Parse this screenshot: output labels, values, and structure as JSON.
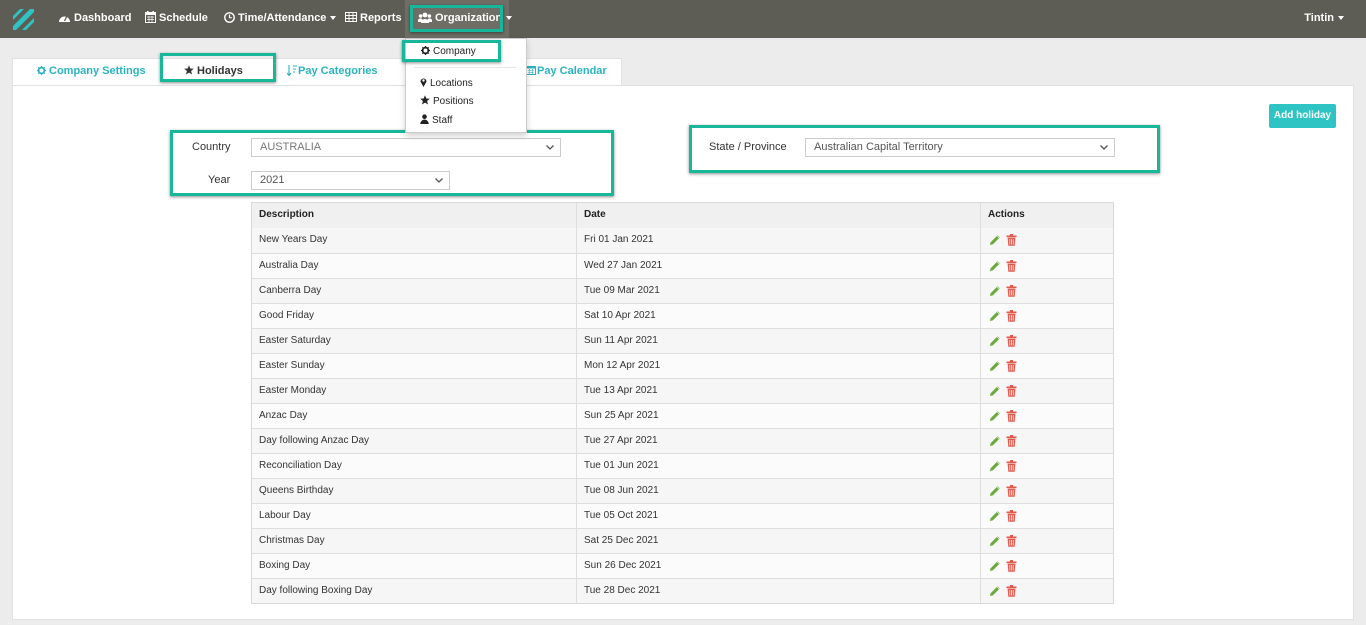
{
  "nav": {
    "items": [
      {
        "label": "Dashboard",
        "icon": "dashboard-icon"
      },
      {
        "label": "Schedule",
        "icon": "calendar-icon"
      },
      {
        "label": "Time/Attendance",
        "icon": "clock-icon"
      },
      {
        "label": "Reports",
        "icon": "table-icon"
      },
      {
        "label": "Organization",
        "icon": "group-icon"
      }
    ],
    "user": "Tintin",
    "bg_color": "#5d5d55",
    "highlight_color": "#17b89a"
  },
  "dropdown": {
    "items": [
      {
        "label": "Company",
        "icon": "gear-icon"
      },
      {
        "label": "Locations",
        "icon": "map-marker-icon"
      },
      {
        "label": "Positions",
        "icon": "star-icon"
      },
      {
        "label": "Staff",
        "icon": "user-icon"
      }
    ]
  },
  "tabs": [
    {
      "label": "Company Settings",
      "icon": "gear-icon"
    },
    {
      "label": "Holidays",
      "icon": "star-icon",
      "active": true
    },
    {
      "label": "Pay Categories",
      "icon": "sort-icon"
    },
    {
      "label": "Pay Calendar",
      "icon": "calendar-icon"
    }
  ],
  "filters": {
    "country_label": "Country",
    "country_value": "AUSTRALIA",
    "year_label": "Year",
    "year_value": "2021",
    "state_label": "State / Province",
    "state_value": "Australian Capital Territory"
  },
  "add_button": "Add holiday",
  "accent_color": "#2ec4c4",
  "table": {
    "headers": [
      "Description",
      "Date",
      "Actions"
    ],
    "rows": [
      {
        "description": "New Years Day",
        "date": "Fri 01 Jan 2021"
      },
      {
        "description": "Australia Day",
        "date": "Wed 27 Jan 2021"
      },
      {
        "description": "Canberra Day",
        "date": "Tue 09 Mar 2021"
      },
      {
        "description": "Good Friday",
        "date": "Sat 10 Apr 2021"
      },
      {
        "description": "Easter Saturday",
        "date": "Sun 11 Apr 2021"
      },
      {
        "description": "Easter Sunday",
        "date": "Mon 12 Apr 2021"
      },
      {
        "description": "Easter Monday",
        "date": "Tue 13 Apr 2021"
      },
      {
        "description": "Anzac Day",
        "date": "Sun 25 Apr 2021"
      },
      {
        "description": "Day following Anzac Day",
        "date": "Tue 27 Apr 2021"
      },
      {
        "description": "Reconciliation Day",
        "date": "Tue 01 Jun 2021"
      },
      {
        "description": "Queens Birthday",
        "date": "Tue 08 Jun 2021"
      },
      {
        "description": "Labour Day",
        "date": "Tue 05 Oct 2021"
      },
      {
        "description": "Christmas Day",
        "date": "Sat 25 Dec 2021"
      },
      {
        "description": "Boxing Day",
        "date": "Sun 26 Dec 2021"
      },
      {
        "description": "Day following Boxing Day",
        "date": "Tue 28 Dec 2021"
      }
    ]
  }
}
